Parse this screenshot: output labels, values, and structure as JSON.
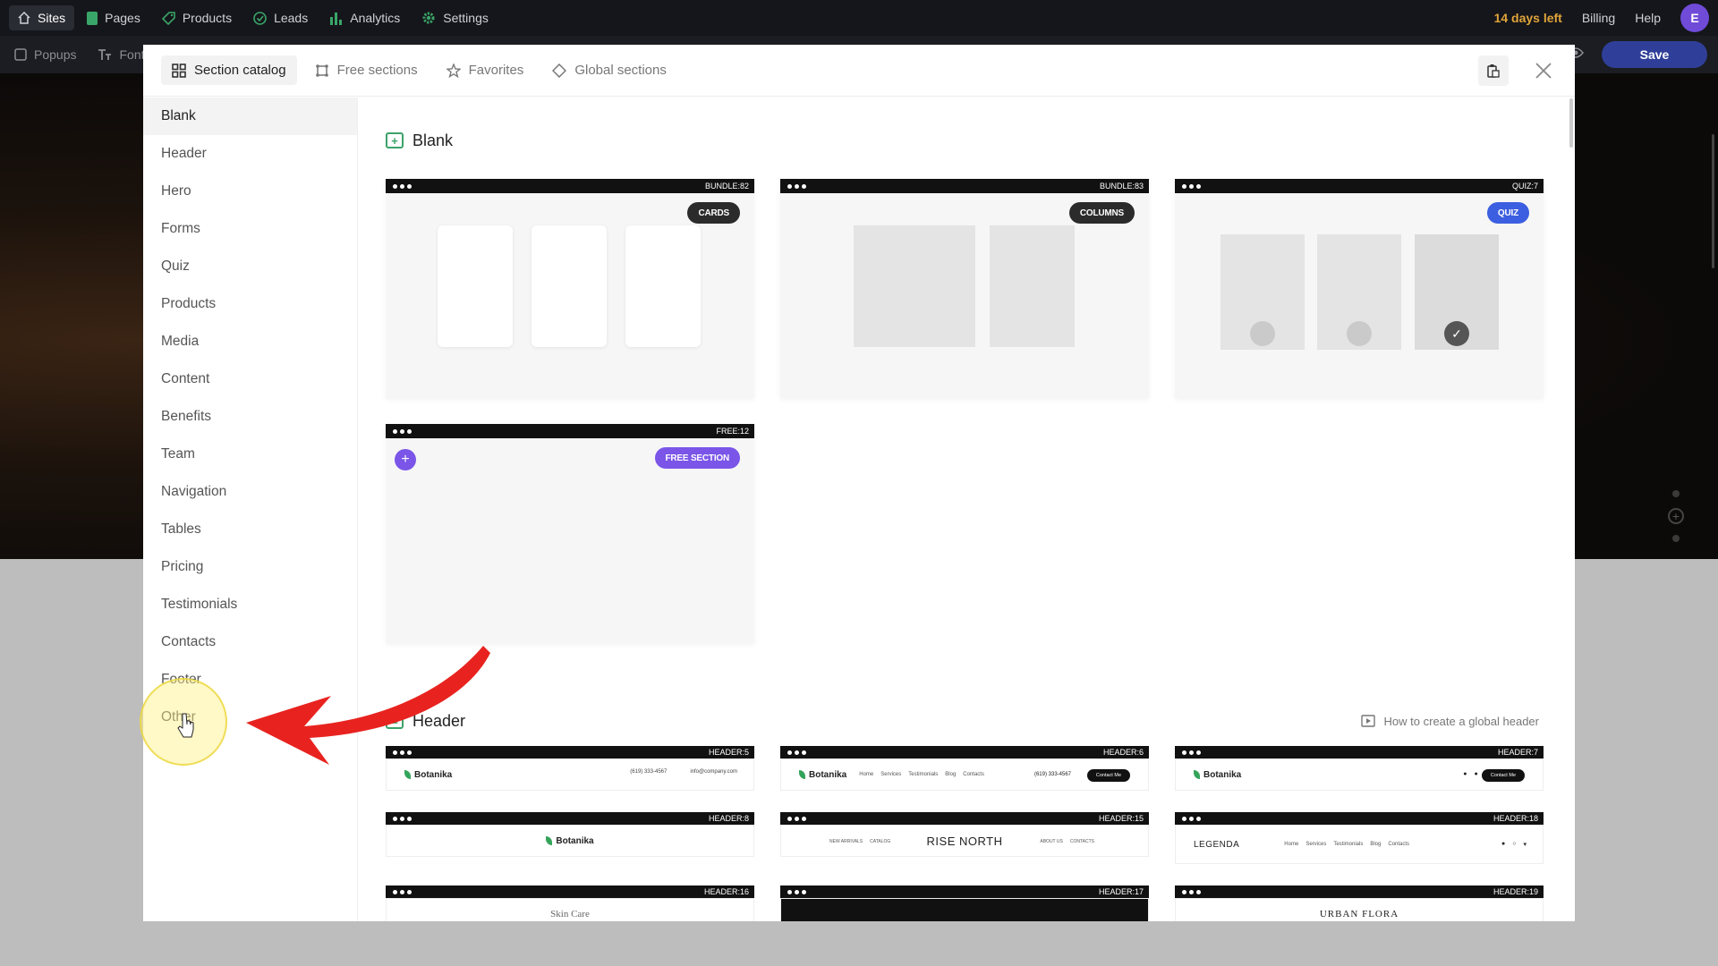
{
  "topbar": {
    "nav": [
      {
        "label": "Sites",
        "icon": "home-icon"
      },
      {
        "label": "Pages",
        "icon": "pages-icon"
      },
      {
        "label": "Products",
        "icon": "tag-icon"
      },
      {
        "label": "Leads",
        "icon": "target-icon"
      },
      {
        "label": "Analytics",
        "icon": "bar-chart-icon"
      },
      {
        "label": "Settings",
        "icon": "gear-icon"
      }
    ],
    "trial": "14 days left",
    "billing": "Billing",
    "help": "Help",
    "avatar_initial": "E"
  },
  "toolbar2": {
    "items": [
      {
        "label": "Popups"
      },
      {
        "label": "Font"
      }
    ],
    "save_label": "Save"
  },
  "modal": {
    "tabs": [
      {
        "label": "Section catalog",
        "active": true
      },
      {
        "label": "Free sections"
      },
      {
        "label": "Favorites"
      },
      {
        "label": "Global sections"
      }
    ],
    "sidebar": [
      "Blank",
      "Header",
      "Hero",
      "Forms",
      "Quiz",
      "Products",
      "Media",
      "Content",
      "Benefits",
      "Team",
      "Navigation",
      "Tables",
      "Pricing",
      "Testimonials",
      "Contacts",
      "Footer",
      "Other"
    ],
    "blank_section": {
      "title": "Blank",
      "cards": [
        {
          "code": "BUNDLE:82",
          "badge": "CARDS"
        },
        {
          "code": "BUNDLE:83",
          "badge": "COLUMNS"
        },
        {
          "code": "QUIZ:7",
          "badge": "QUIZ"
        },
        {
          "code": "FREE:12",
          "badge": "FREE SECTION"
        }
      ]
    },
    "header_section": {
      "title": "Header",
      "howto": "How to create a global header",
      "cards": [
        {
          "code": "HEADER:5",
          "logo": "Botanika",
          "contact1": "(619) 333-4567",
          "contact2": "info@company.com"
        },
        {
          "code": "HEADER:6",
          "logo": "Botanika",
          "nav": [
            "Home",
            "Services",
            "Testimonials",
            "Blog",
            "Contacts"
          ],
          "phone": "(619) 333-4567",
          "btn": "Contact Me"
        },
        {
          "code": "HEADER:7",
          "logo": "Botanika",
          "btn": "Contact Me"
        },
        {
          "code": "HEADER:8",
          "logo": "Botanika"
        },
        {
          "code": "HEADER:15",
          "logo": "RISE NORTH",
          "left_nav": [
            "NEW ARRIVALS",
            "CATALOG"
          ],
          "right_nav": [
            "ABOUT US",
            "CONTACTS"
          ]
        },
        {
          "code": "HEADER:18",
          "logo": "LEGENDA",
          "nav": [
            "Home",
            "Services",
            "Testimonials",
            "Blog",
            "Contacts"
          ]
        },
        {
          "code": "HEADER:16",
          "logo": "Skin Care"
        },
        {
          "code": "HEADER:17",
          "logo": ""
        },
        {
          "code": "HEADER:19",
          "logo": "URBAN FLORA"
        }
      ]
    }
  },
  "colors": {
    "save": "#2f3f99",
    "trial": "#e0a43a",
    "quiz_badge": "#3c5ee0",
    "free_badge": "#7a55e8",
    "arrow": "#e8231f",
    "highlight": "#f5e66a"
  }
}
